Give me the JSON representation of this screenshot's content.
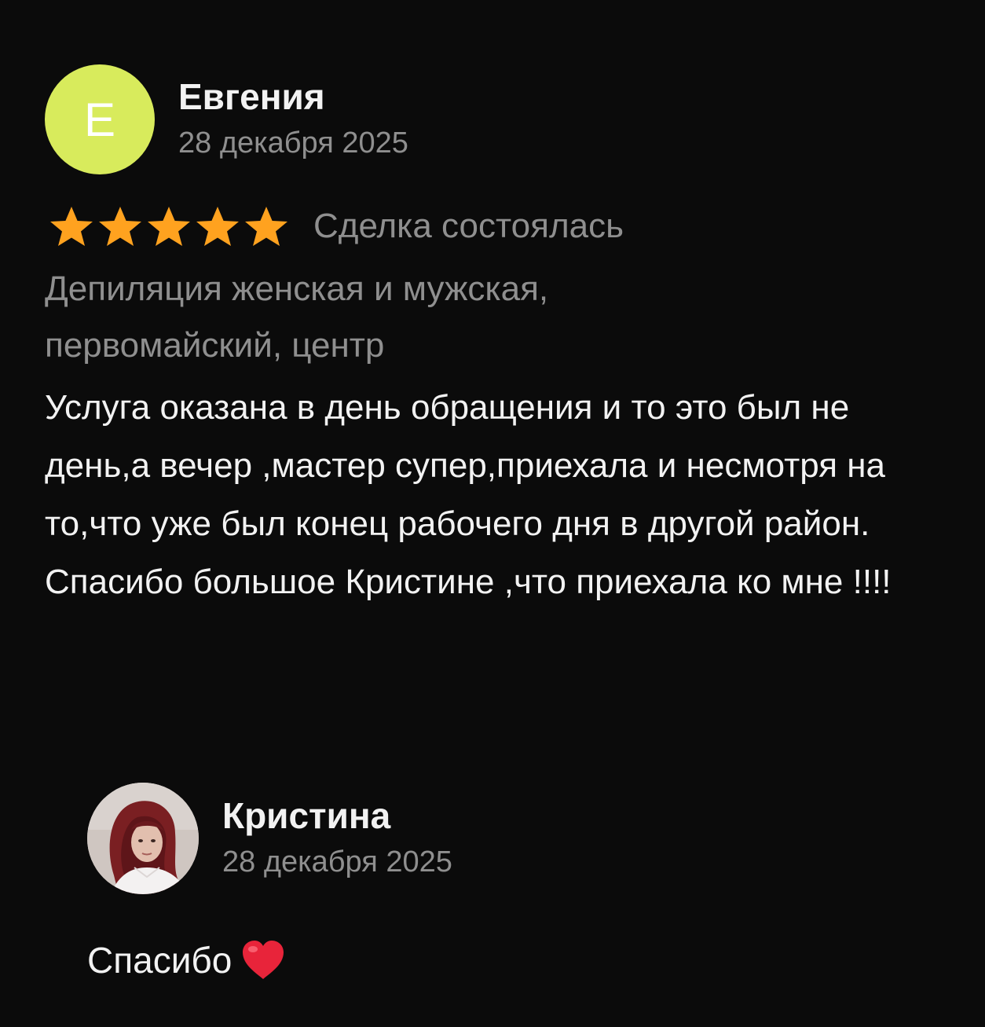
{
  "review": {
    "author": {
      "initial": "Е",
      "name": "Евгения",
      "date": "28 декабря 2025",
      "avatar_color": "#d8eb5c"
    },
    "rating": 5,
    "star_color": "#ffa21f",
    "deal_status": "Сделка состоялась",
    "service": "Депиляция женская и мужская, первомайский, центр",
    "text": "Услуга оказана в день обращения и то это был не день,а вечер ,мастер супер,приехала и несмотря на то,что уже был конец рабочего дня в другой район.\nСпасибо большое Кристине ,что приехала ко мне !!!!"
  },
  "reply": {
    "author": {
      "name": "Кристина",
      "date": "28 декабря 2025",
      "avatar_icon": "profile-photo"
    },
    "text": "Спасибо",
    "emoji_icon": "red-heart-icon",
    "heart_color": "#e8243a"
  }
}
